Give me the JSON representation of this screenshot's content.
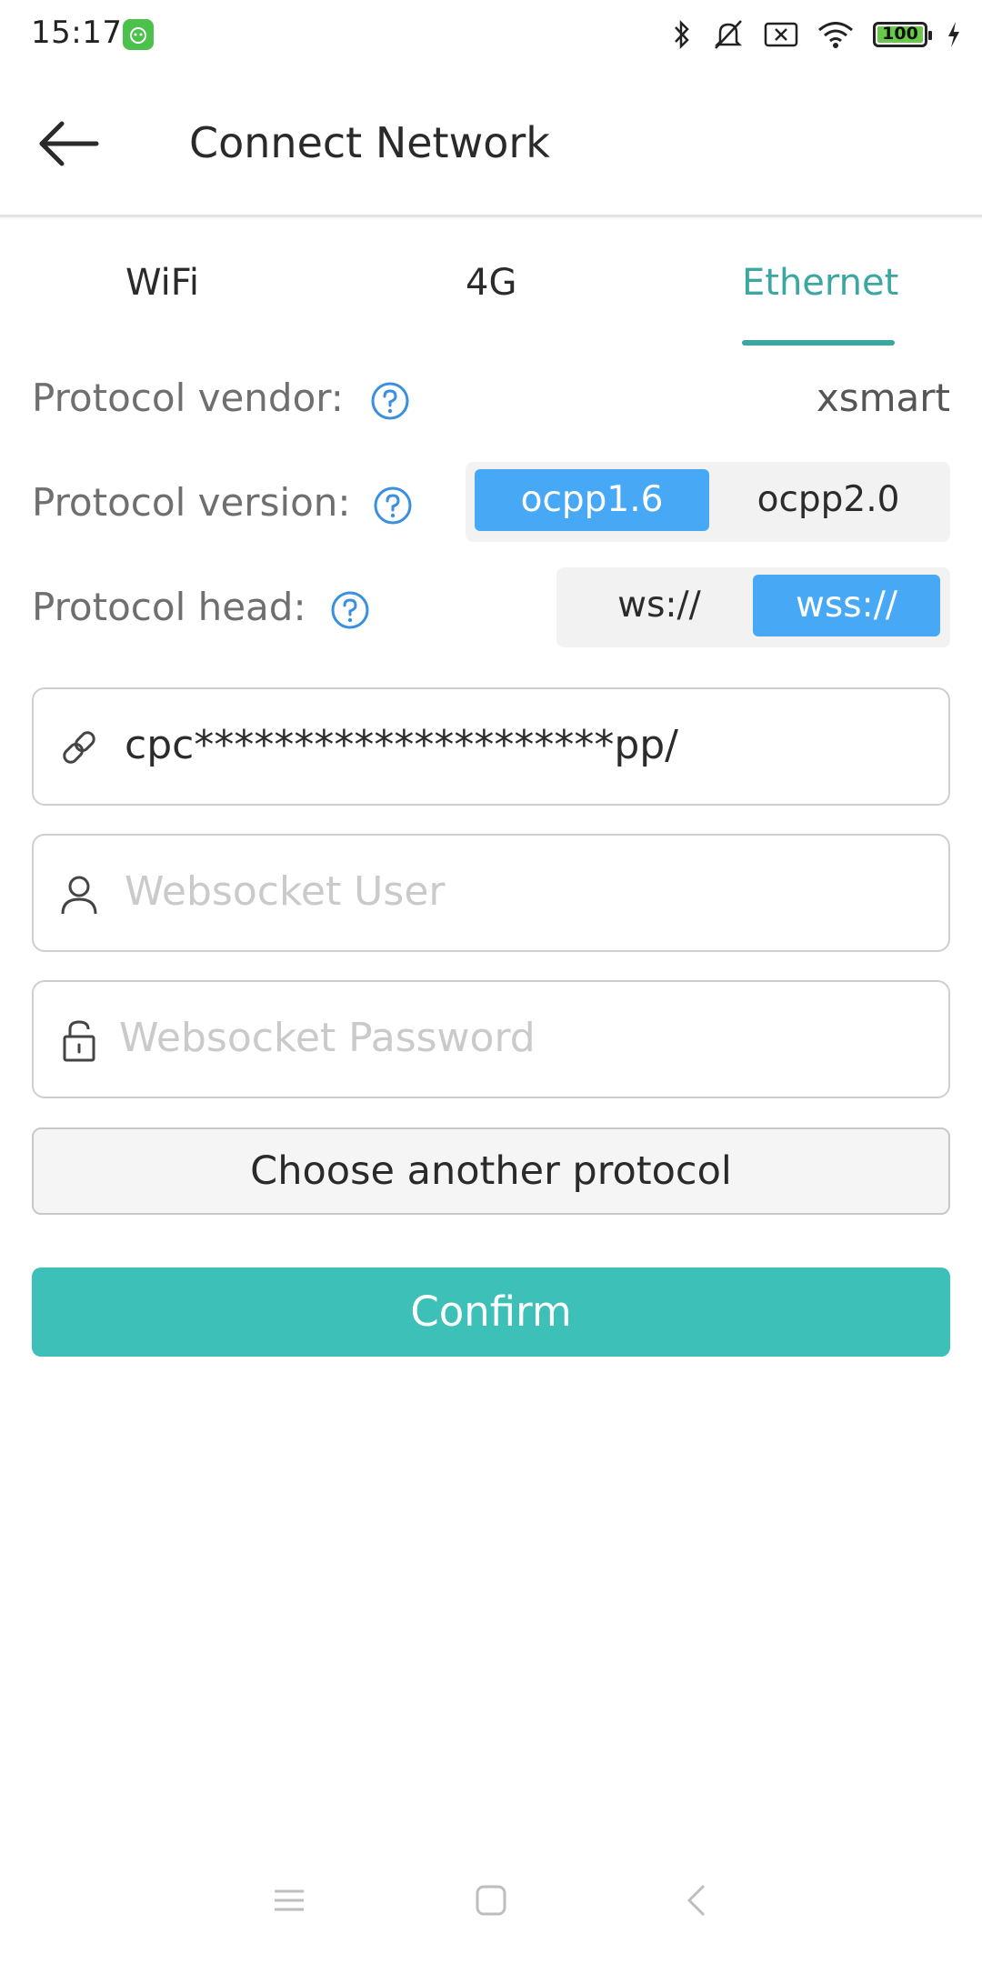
{
  "status_bar": {
    "time": "15:17",
    "battery_level": "100",
    "icons": [
      "app-notification-icon",
      "bluetooth-icon",
      "silent-icon",
      "no-sim-icon",
      "wifi-icon",
      "battery-icon",
      "charging-icon"
    ]
  },
  "header": {
    "title": "Connect Network",
    "back_icon": "arrow-left-icon"
  },
  "tabs": [
    {
      "label": "WiFi",
      "active": false
    },
    {
      "label": "4G",
      "active": false
    },
    {
      "label": "Ethernet",
      "active": true
    }
  ],
  "protocol": {
    "vendor_label": "Protocol vendor:",
    "vendor_value": "xsmart",
    "version_label": "Protocol version:",
    "version_options": [
      "ocpp1.6",
      "ocpp2.0"
    ],
    "version_selected": "ocpp1.6",
    "head_label": "Protocol head:",
    "head_options": [
      "ws://",
      "wss://"
    ],
    "head_selected": "wss://"
  },
  "form": {
    "url_value": "cpc*********************pp/",
    "user_placeholder": "Websocket User",
    "password_placeholder": "Websocket Password"
  },
  "buttons": {
    "choose_other": "Choose another protocol",
    "confirm": "Confirm"
  },
  "colors": {
    "accent_teal": "#3aa8a0",
    "confirm_bg": "#3cc0b8",
    "segment_active": "#47a9f5",
    "help_icon": "#3a8fe0"
  }
}
